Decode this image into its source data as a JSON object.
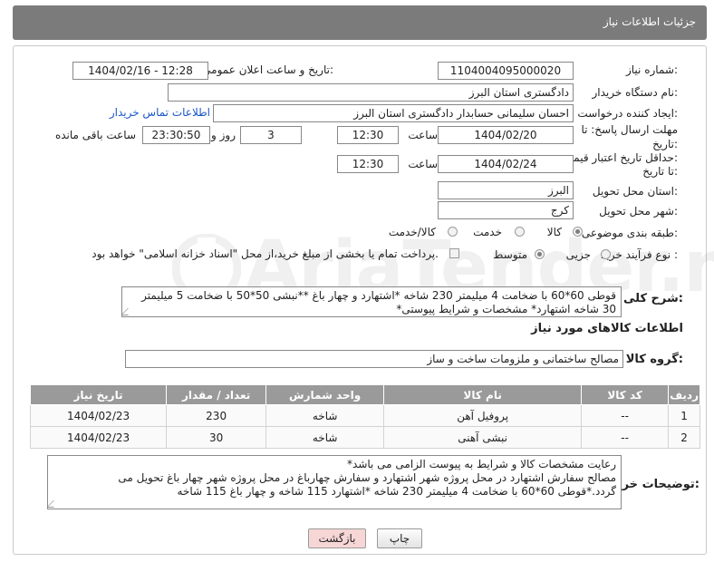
{
  "header": {
    "title": "جزئیات اطلاعات نیاز"
  },
  "fields": {
    "need_number_label": "شماره نیاز:",
    "need_number": "1104004095000020",
    "announce_label": "تاریخ و ساعت اعلان عمومی:",
    "announce_value": "1404/02/16 - 12:28",
    "buyer_label": "نام دستگاه خریدار:",
    "buyer_value": "دادگستری استان البرز",
    "creator_label": "ایجاد کننده درخواست:",
    "creator_value": "احسان سلیمانی حسابدار دادگستری استان البرز",
    "contact_link": "اطلاعات تماس خریدار",
    "deadline_label_1": "مهلت ارسال پاسخ: تا",
    "deadline_label_2": "تاریخ:",
    "deadline_date": "1404/02/20",
    "time_label": "ساعت",
    "deadline_time": "12:30",
    "day_count": "3",
    "day_label": "روز و",
    "remaining_time": "23:30:50",
    "remaining_label": "ساعت باقی مانده",
    "validity_label_1": "حداقل تاریخ اعتبار قیمت:",
    "validity_label_2": "تا تاریخ:",
    "validity_date": "1404/02/24",
    "validity_time": "12:30",
    "province_label": "استان محل تحویل:",
    "province_value": "البرز",
    "city_label": "شهر محل تحویل:",
    "city_value": "کرج",
    "category_label": "طبقه بندی موضوعی:",
    "category_options": [
      "کالا",
      "خدمت",
      "کالا/خدمت"
    ],
    "category_selected": "کالا",
    "process_label": "نوع فرآیند خرید :",
    "process_options": [
      "جزیی",
      "متوسط"
    ],
    "process_selected": "متوسط",
    "payment_note": "پرداخت تمام یا بخشی از مبلغ خرید،از محل \"اسناد خزانه اسلامی\" خواهد بود.",
    "description_label": "شرح کلی نیاز:",
    "description_value": "قوطی 60*60 با ضخامت 4 میلیمتر 230 شاخه *اشتهارد و چهار باغ **نبشی 50*50 با ضخامت 5 میلیمتر 30 شاخه اشتهارد* مشخصات  و شرایط پیوستی*"
  },
  "items_section": {
    "title": "اطلاعات کالاهای مورد نیاز",
    "group_label": "گروه کالا:",
    "group_value": "مصالح ساختمانی و ملزومات ساخت و ساز",
    "columns": [
      "ردیف",
      "کد کالا",
      "نام کالا",
      "واحد شمارش",
      "تعداد / مقدار",
      "تاریخ نیاز"
    ],
    "rows": [
      {
        "index": "1",
        "code": "--",
        "name": "پروفیل آهن",
        "unit": "شاخه",
        "qty": "230",
        "date": "1404/02/23"
      },
      {
        "index": "2",
        "code": "--",
        "name": "نبشی آهنی",
        "unit": "شاخه",
        "qty": "30",
        "date": "1404/02/23"
      }
    ]
  },
  "buyer_notes": {
    "label": "توضیحات خریدار:",
    "line1": "رعایت مشخصات کالا و شرایط به پیوست الزامی می باشد*",
    "line2": "مصالح سفارش اشتهارد در محل پروژه  شهر اشتهارد و سفارش چهارباغ  در محل پروژه  شهر چهار باغ تحویل می",
    "line3": "گردد.*قوطی 60*60 با ضخامت 4 میلیمتر 230 شاخه *اشتهارد 115 شاخه  و چهار باغ 115 شاخه"
  },
  "buttons": {
    "print": "چاپ",
    "back": "بازگشت"
  },
  "watermark": {
    "text": "AriaTender.neT"
  },
  "colors": {
    "header_bg": "#7b7b7b",
    "table_header_bg": "#9a9a9a",
    "back_button_bg": "#f7d6d6",
    "link": "#1a56c9"
  }
}
